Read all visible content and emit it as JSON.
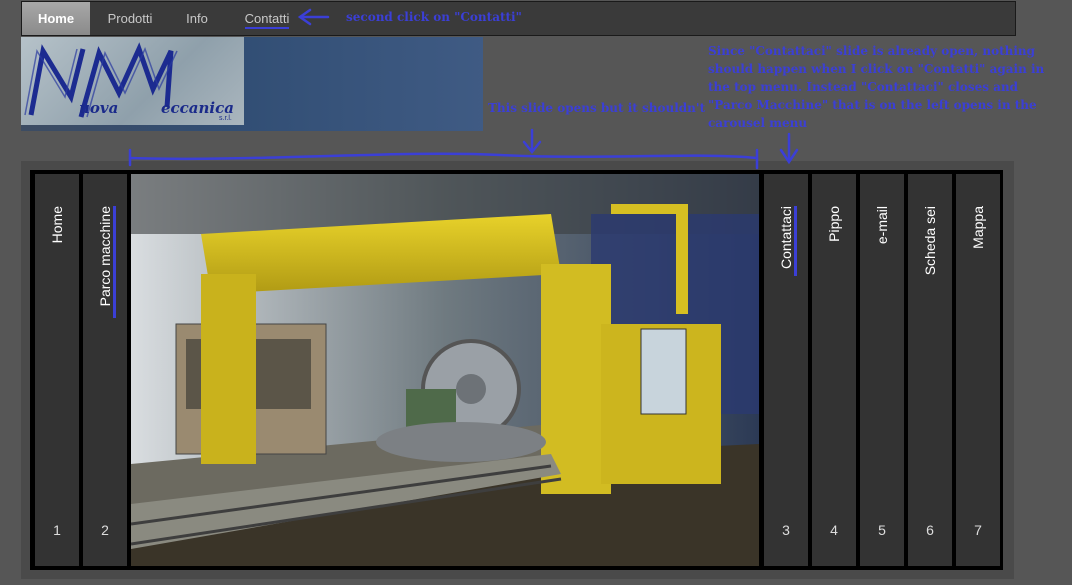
{
  "topnav": {
    "items": [
      {
        "label": "Home"
      },
      {
        "label": "Prodotti"
      },
      {
        "label": "Info"
      },
      {
        "label": "Contatti"
      }
    ]
  },
  "logo": {
    "word1": "uova",
    "word2": "eccanica",
    "srl": "s.r.l."
  },
  "annotations": {
    "second_click": "second click on \"Contatti\"",
    "wrong_slide": "This slide opens but it shouldn't",
    "explanation": "Since \"Contattaci\" slide is already open, nothing should happen when I click on \"Contatti\" again in the top menu. Instead \"Contattaci\" closes and \"Parco Macchine\" that is on the left   opens in the carousel menu"
  },
  "carousel": {
    "left_slides": [
      {
        "label": "Home",
        "number": "1"
      },
      {
        "label": "Parco macchine",
        "number": "2"
      }
    ],
    "right_slides": [
      {
        "label": "Contattaci",
        "number": "3"
      },
      {
        "label": "Pippo",
        "number": "4"
      },
      {
        "label": "e-mail",
        "number": "5"
      },
      {
        "label": "Scheda sei",
        "number": "6"
      },
      {
        "label": "Mappa",
        "number": "7"
      }
    ]
  },
  "colors": {
    "annotation": "#3b3fd6",
    "machine": "#d8c21e",
    "background": "#565656"
  }
}
